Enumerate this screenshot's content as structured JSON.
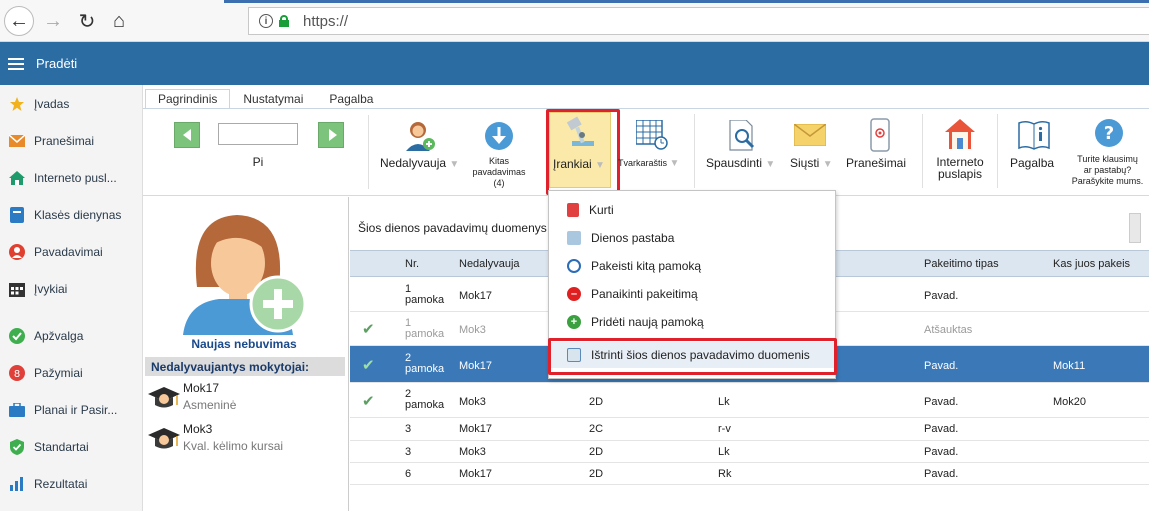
{
  "browser": {
    "url": "https://",
    "info_glyph": "i"
  },
  "header": {
    "title": "Pradėti"
  },
  "sidebar": {
    "items": [
      {
        "label": "Įvadas",
        "icon": "star-icon",
        "color": "#f1b21c"
      },
      {
        "label": "Pranešimai",
        "icon": "envelope-icon",
        "color": "#e98a2a"
      },
      {
        "label": "Interneto pusl...",
        "icon": "house-icon",
        "color": "#1f9a6a"
      },
      {
        "label": "Klasės dienynas",
        "icon": "book-icon",
        "color": "#2a7bc4"
      },
      {
        "label": "Pavadavimai",
        "icon": "person-icon",
        "color": "#e04030"
      },
      {
        "label": "Įvykiai",
        "icon": "calendar-icon",
        "color": "#333333"
      },
      {
        "label": "Apžvalga",
        "icon": "check-circle-icon",
        "color": "#3fae4f"
      },
      {
        "label": "Pažymiai",
        "icon": "grade-icon",
        "color": "#e0403a"
      },
      {
        "label": "Planai ir Pasir...",
        "icon": "briefcase-icon",
        "color": "#2a7bc4"
      },
      {
        "label": "Standartai",
        "icon": "shield-icon",
        "color": "#3fae4f"
      },
      {
        "label": "Rezultatai",
        "icon": "bar-chart-icon",
        "color": "#2a7bc4"
      }
    ]
  },
  "ribbon": {
    "tabs": [
      "Pagrindinis",
      "Nustatymai",
      "Pagalba"
    ],
    "page_label": "Pi",
    "nedalyvauja": "Nedalyvauja",
    "kitas_line1": "Kitas",
    "kitas_line2": "pavadavimas",
    "kitas_line3": "(4)",
    "irankiai": "Įrankiai",
    "tvarkarastis": "Tvarkaraštis",
    "spausdinti": "Spausdinti",
    "siusti": "Siųsti",
    "pranesimai": "Pranešimai",
    "internet_line1": "Interneto",
    "internet_line2": "puslapis",
    "pagalba": "Pagalba",
    "help_line1": "Turite klausimų",
    "help_line2": "ar pastabų?",
    "help_line3": "Parašykite mums."
  },
  "left_panel": {
    "new_absence": "Naujas nebuvimas",
    "absent_heading": "Nedalyvaujantys mokytojai:",
    "teachers": [
      {
        "name": "Mok17",
        "reason": "Asmeninė"
      },
      {
        "name": "Mok3",
        "reason": "Kval. kėlimo kursai"
      }
    ]
  },
  "table": {
    "title": "Šios dienos pavadavimų duomenys",
    "headers": {
      "nr": "Nr.",
      "nedalyvauja": "Nedalyvauja",
      "tipas": "Pakeitimo tipas",
      "kas": "Kas juos pakeis"
    },
    "rows": [
      {
        "check": "",
        "nr1": "1",
        "nr2": "pamoka",
        "ned": "Mok17",
        "cls": "",
        "subj": "",
        "type": "Pavad.",
        "who": ""
      },
      {
        "check": "✔",
        "nr1": "1",
        "nr2": "pamoka",
        "ned": "Mok3",
        "cls": "",
        "subj": "",
        "type": "Atšauktas",
        "who": ""
      },
      {
        "check": "✔",
        "nr1": "2",
        "nr2": "pamoka",
        "ned": "Mok17",
        "cls": "",
        "subj": "",
        "type": "Pavad.",
        "who": "Mok11"
      },
      {
        "check": "✔",
        "nr1": "2",
        "nr2": "pamoka",
        "ned": "Mok3",
        "cls": "2D",
        "subj": "Lk",
        "type": "Pavad.",
        "who": "Mok20"
      },
      {
        "check": "",
        "nr1": "3",
        "nr2": "",
        "ned": "Mok17",
        "cls": "2C",
        "subj": "r-v",
        "type": "Pavad.",
        "who": ""
      },
      {
        "check": "",
        "nr1": "3",
        "nr2": "",
        "ned": "Mok3",
        "cls": "2D",
        "subj": "Lk",
        "type": "Pavad.",
        "who": ""
      },
      {
        "check": "",
        "nr1": "6",
        "nr2": "",
        "ned": "Mok17",
        "cls": "2D",
        "subj": "Rk",
        "type": "Pavad.",
        "who": ""
      }
    ]
  },
  "dropdown": {
    "items": [
      {
        "label": "Kurti",
        "icon": "create-icon",
        "color": "#e04040"
      },
      {
        "label": "Dienos pastaba",
        "icon": "note-icon",
        "color": "#8ab4d8"
      },
      {
        "label": "Pakeisti kitą pamoką",
        "icon": "swap-icon",
        "color": "#2a6cb8"
      },
      {
        "label": "Panaikinti pakeitimą",
        "icon": "remove-icon",
        "color": "#e02020"
      },
      {
        "label": "Pridėti naują pamoką",
        "icon": "add-icon",
        "color": "#3aa040"
      },
      {
        "label": "Ištrinti šios dienos pavadavimo duomenis",
        "icon": "erase-icon",
        "color": "#5a8ab8"
      }
    ]
  }
}
